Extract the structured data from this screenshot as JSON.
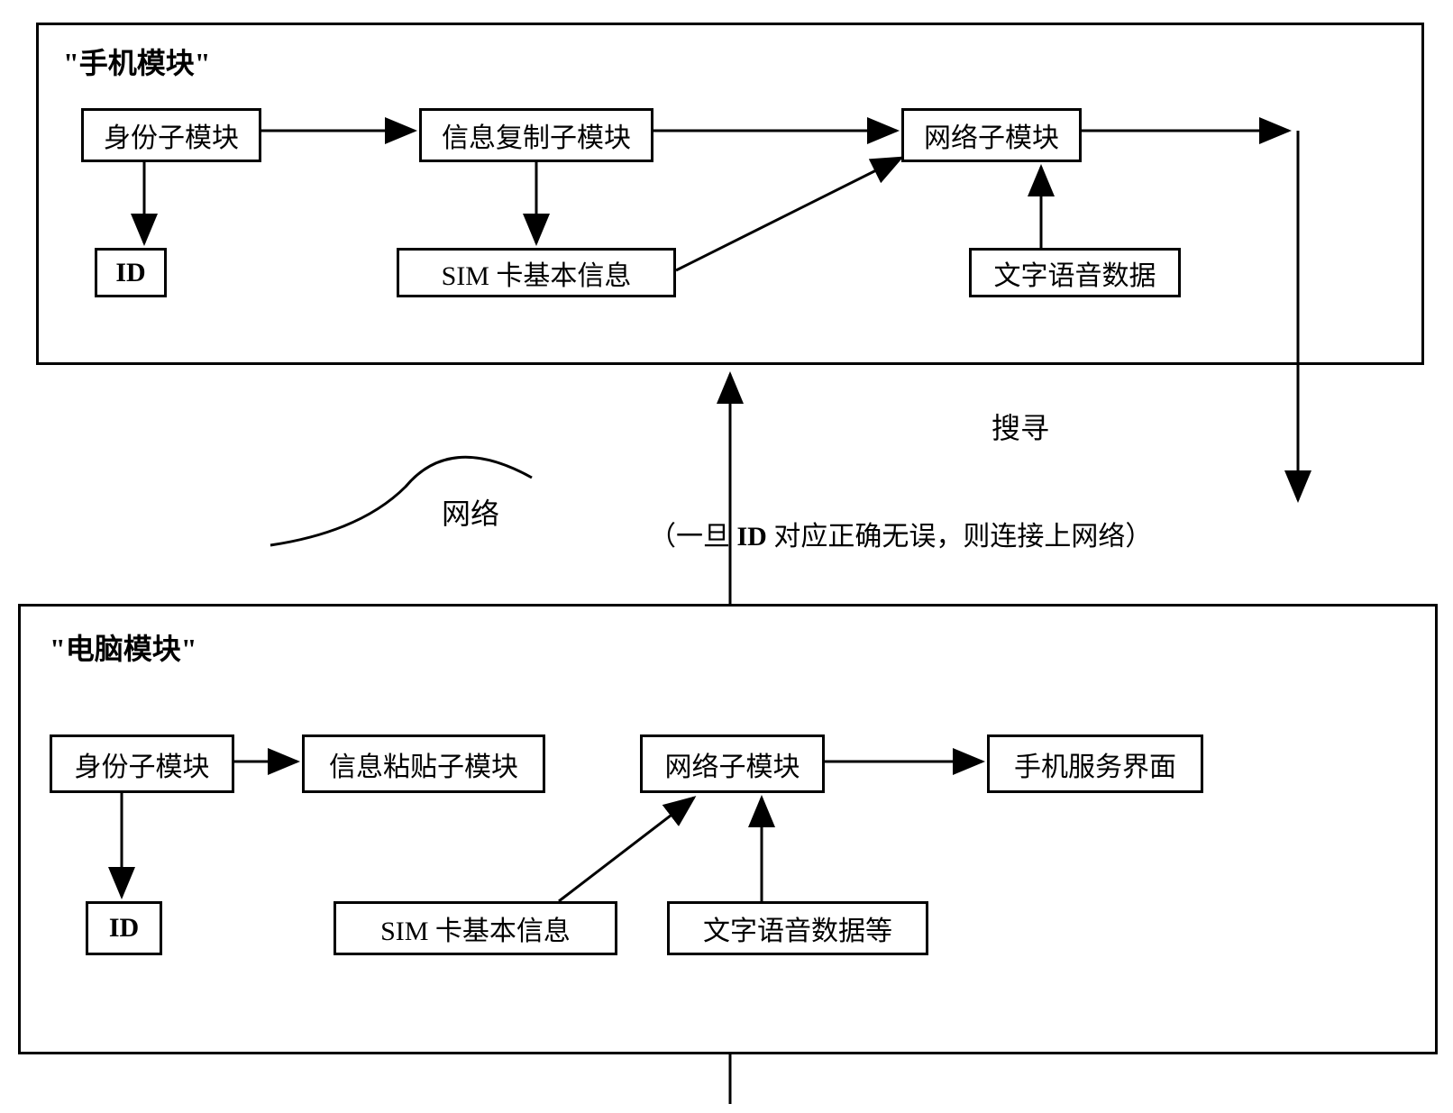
{
  "phone_module": {
    "title": "\"手机模块\"",
    "identity_sub": "身份子模块",
    "info_copy_sub": "信息复制子模块",
    "network_sub": "网络子模块",
    "id": "ID",
    "sim_info": "SIM 卡基本信息",
    "text_voice_data": "文字语音数据"
  },
  "computer_module": {
    "title": "\"电脑模块\"",
    "identity_sub": "身份子模块",
    "info_paste_sub": "信息粘贴子模块",
    "network_sub": "网络子模块",
    "phone_service_ui": "手机服务界面",
    "id": "ID",
    "sim_info": "SIM 卡基本信息",
    "text_voice_data": "文字语音数据等"
  },
  "labels": {
    "network": "网络",
    "search": "搜寻",
    "annotation_prefix": "（一旦 ",
    "annotation_id": "ID",
    "annotation_suffix": " 对应正确无误，则连接上网络）"
  }
}
